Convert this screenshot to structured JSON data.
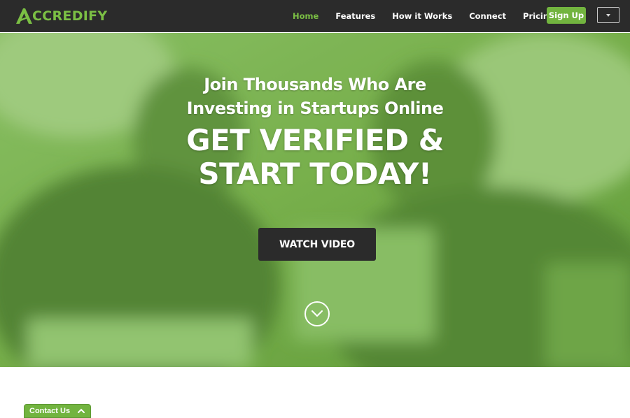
{
  "brand": {
    "name": "ACCREDIFY",
    "logo_letter": "A",
    "logo_rest": "CCREDIFY",
    "color": "#7bbf44"
  },
  "nav": {
    "items": [
      {
        "label": "Home",
        "active": true
      },
      {
        "label": "Features",
        "active": false
      },
      {
        "label": "How it Works",
        "active": false
      },
      {
        "label": "Connect",
        "active": false
      },
      {
        "label": "Pricing",
        "active": false
      }
    ],
    "signup_label": "Sign Up",
    "dropdown_icon": "caret-down-icon"
  },
  "hero": {
    "subtitle_line1": "Join Thousands Who Are",
    "subtitle_line2": "Investing in Startups Online",
    "title_line1": "GET VERIFIED &",
    "title_line2": "START TODAY!",
    "cta_label": "WATCH VIDEO",
    "scroll_icon": "chevron-down-circle-icon",
    "overlay_color": "#6fa845"
  },
  "contact": {
    "label": "Contact Us",
    "icon": "chevron-up-icon"
  },
  "colors": {
    "accent": "#72b43f",
    "navbar": "#2b2b2b",
    "button_dark": "#2b2b2b"
  }
}
